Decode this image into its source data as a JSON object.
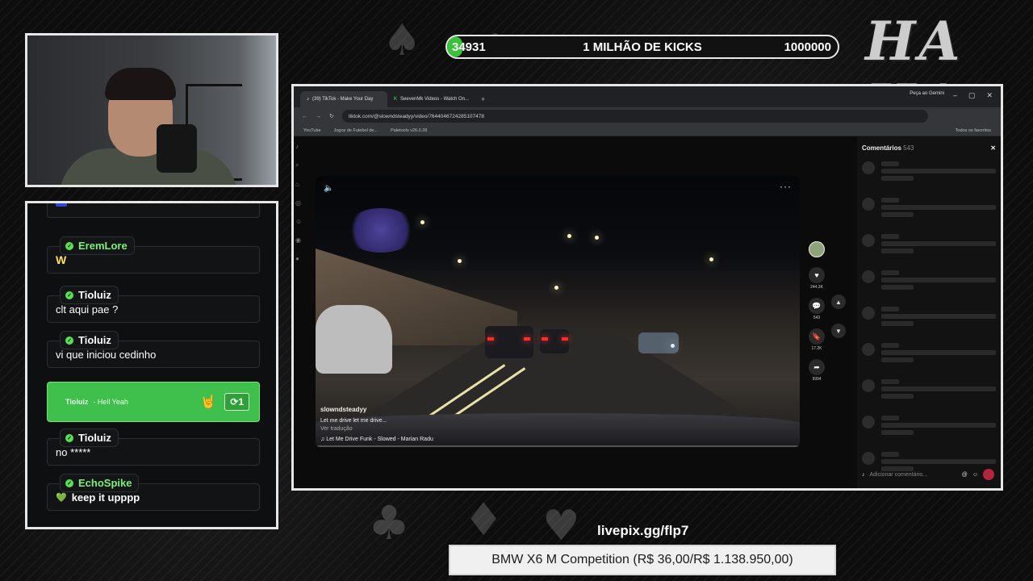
{
  "overlay": {
    "goal": {
      "current": "34931",
      "title": "1 MILHÃO DE KICKS",
      "target": "1000000",
      "progress": 0.035
    },
    "brand_text": "HA HA",
    "pix_link": "livepix.gg/flp7",
    "product_banner": "BMW X6 M Competition (R$ 36,00/R$ 1.138.950,00)"
  },
  "chat": {
    "messages": [
      {
        "user": "EremLore",
        "text": "W"
      },
      {
        "user": "Tioluiz",
        "text": "clt aqui pae ?"
      },
      {
        "user": "Tioluiz",
        "text": "vi que iniciou cedinho"
      },
      {
        "user": "Tioluiz",
        "text": "no *****"
      },
      {
        "user": "EchoSpike",
        "text": "keep it upppp",
        "emoji": "💚"
      }
    ],
    "highlight": {
      "user": "Tioluiz",
      "text": "- Hell Yeah",
      "emoji": "🤘",
      "badge": "⟳1"
    }
  },
  "browser": {
    "tabs": [
      {
        "label": "(39) TikTok - Make Your Day",
        "active": true
      },
      {
        "label": "SeevenMk Videos - Watch On...",
        "active": false
      }
    ],
    "gemini": "Peça ao Gemini",
    "url": "tiktok.com/@slowndsteadyy/video/7644046724285107478",
    "bookmarks": [
      "YouTube",
      "Jogos de Futebol de...",
      "Paletools v26.0.28"
    ],
    "bookmarks_right": "Todos os favoritos",
    "window_controls": [
      "–",
      "▢",
      "✕"
    ]
  },
  "tiktok": {
    "handle": "slowndsteadyy",
    "description": "Let me drive let me drive...",
    "see_translation": "Ver tradução",
    "sound": "♫  Let Me Drive Funk - Slowed - Marian Radu",
    "likes": "244.3K",
    "comments_count": "543",
    "saves": "17.2K",
    "shares": "9994",
    "comments_title": "Comentários",
    "comments_total": "543",
    "add_comment_placeholder": "Adicionar comentário..."
  },
  "colors": {
    "accent_green": "#3fbf4c",
    "name_dot": "#57e34f",
    "goal_fill": "#39c23a"
  }
}
